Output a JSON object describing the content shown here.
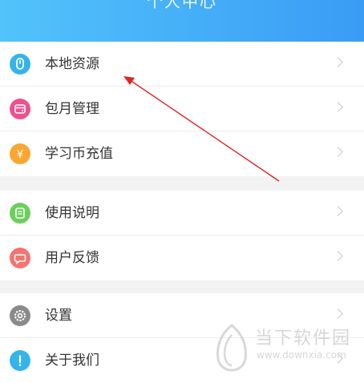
{
  "header": {
    "title": "个人中心",
    "bg_left": "#52c3fb",
    "bg_right": "#3a9cf5"
  },
  "groups": [
    {
      "items": [
        {
          "label": "本地资源",
          "icon": "local-resource-icon",
          "color": "#35b4ea"
        },
        {
          "label": "包月管理",
          "icon": "wallet-icon",
          "color": "#f0508e"
        },
        {
          "label": "学习币充值",
          "icon": "yen-coin-icon",
          "color": "#f8a732"
        }
      ]
    },
    {
      "items": [
        {
          "label": "使用说明",
          "icon": "document-icon",
          "color": "#6ccf5c"
        },
        {
          "label": "用户反馈",
          "icon": "feedback-icon",
          "color": "#f47470"
        }
      ]
    },
    {
      "items": [
        {
          "label": "设置",
          "icon": "gear-icon",
          "color": "#8a8a8a"
        },
        {
          "label": "关于我们",
          "icon": "info-icon",
          "color": "#35b4ea"
        }
      ]
    }
  ],
  "annotation": {
    "arrow_color": "#e02424"
  },
  "watermark": {
    "name": "当下软件园",
    "url": "www.downxia.com",
    "color": "#d0d0d0"
  }
}
